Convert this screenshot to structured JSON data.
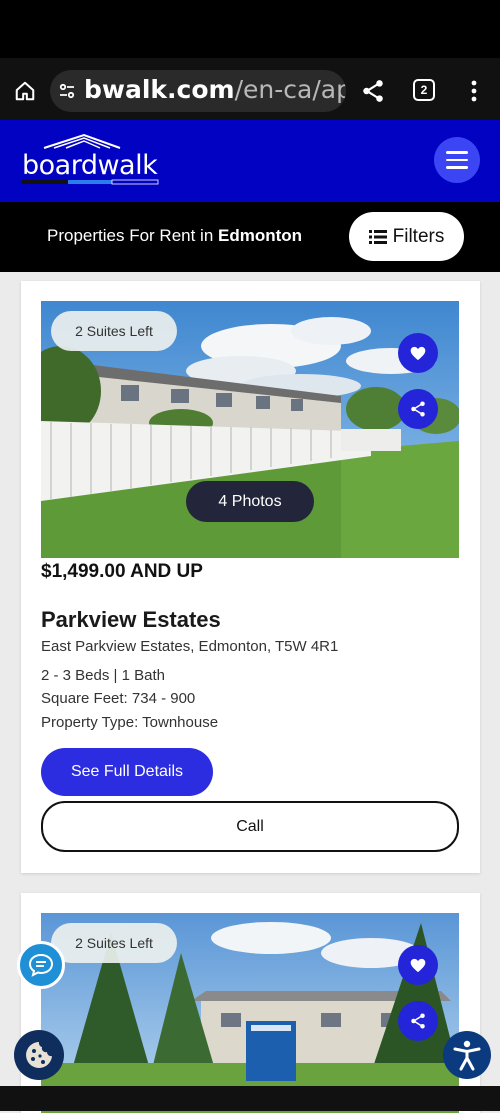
{
  "browser": {
    "url_host": "bwalk.com",
    "url_path": "/en-ca/ap",
    "tab_count": "2"
  },
  "site": {
    "logo_text": "boardwalk"
  },
  "filter_bar": {
    "title_prefix": "Properties For Rent in ",
    "city": "Edmonton",
    "filters_label": "Filters"
  },
  "listings": [
    {
      "badge": "2 Suites Left",
      "photos_label": "4 Photos",
      "price": "$1,499.00 AND UP",
      "name": "Parkview Estates",
      "address": "East Parkview Estates, Edmonton, T5W 4R1",
      "beds_baths": "2 - 3 Beds | 1 Bath",
      "square_feet": "Square Feet: 734 - 900",
      "property_type": "Property Type: Townhouse",
      "details_label": "See Full Details",
      "call_label": "Call"
    },
    {
      "badge": "2 Suites Left"
    }
  ],
  "colors": {
    "header_blue": "#0202c2",
    "accent_blue": "#2c2ce0",
    "favorite_blue": "#2424d8"
  },
  "icons": [
    "home-icon",
    "site-info-icon",
    "share-icon",
    "tabs-icon",
    "more-vert-icon",
    "menu-icon",
    "list-icon",
    "heart-icon",
    "share-icon",
    "chat-icon",
    "cookie-icon",
    "accessibility-icon"
  ]
}
